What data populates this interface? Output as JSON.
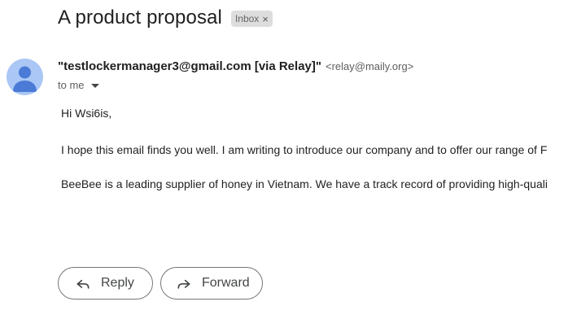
{
  "email": {
    "subject": "A product proposal",
    "label": "Inbox",
    "label_close_glyph": "×",
    "sender_name": "\"testlockermanager3@gmail.com [via Relay]\"",
    "sender_email": "<relay@maily.org>",
    "to_text": "to me",
    "body": [
      "Hi Wsi6is,",
      "I hope this email finds you well. I am writing to introduce our company and to offer our range of F",
      "BeeBee is a leading supplier of honey in Vietnam. We have a track record of providing high-quali"
    ]
  },
  "actions": {
    "reply_label": "Reply",
    "forward_label": "Forward"
  },
  "icons": {
    "avatar": "default-person-avatar-icon",
    "reply": "reply-arrow-icon",
    "forward": "forward-arrow-icon",
    "details": "caret-down-icon"
  },
  "colors": {
    "avatar_bg": "#aac7f5",
    "avatar_fg": "#4b7bd6",
    "chip_bg": "#dddddd"
  }
}
